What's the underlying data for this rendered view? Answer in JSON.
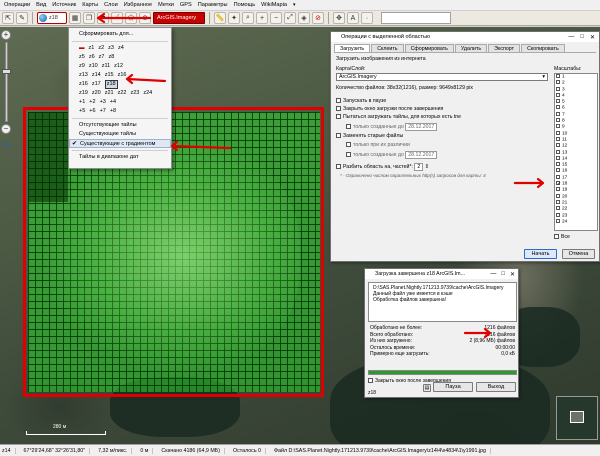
{
  "menu": {
    "items": [
      "Операции",
      "Вид",
      "Источник",
      "Карты",
      "Слои",
      "Избранное",
      "Метки",
      "GPS",
      "Параметры",
      "Помощь"
    ],
    "wikimapia": "WikiMapia"
  },
  "toolbar": {
    "zoom_value": "z18",
    "map_source": "ArcGIS.Imagery"
  },
  "zoom_slider": {
    "label": "z14"
  },
  "dropdown": {
    "header": "Сформировать для...",
    "zoom_rows": [
      [
        "z1",
        "z2",
        "z3",
        "z4"
      ],
      [
        "z5",
        "z6",
        "z7",
        "z8"
      ],
      [
        "z9",
        "z10",
        "z11",
        "z12"
      ],
      [
        "z13",
        "z14",
        "z15",
        "z16"
      ],
      [
        "z16",
        "z17",
        "z18"
      ],
      [
        "z19",
        "z20",
        "z21",
        "z22",
        "z23",
        "z24"
      ]
    ],
    "offset_rows": [
      [
        "+1",
        "+2",
        "+3",
        "+4"
      ],
      [
        "+5",
        "+6",
        "+7",
        "+8"
      ]
    ],
    "highlighted_zoom": "z18",
    "options": [
      "Отсутствующие тайлы",
      "Существующие тайлы",
      "Существующие с градиентом"
    ],
    "checked_option": "Существующие с градиентом",
    "footer": "Тайлы в диапазоне дат"
  },
  "op_dialog": {
    "title": "Операции с выделенной областью",
    "tabs": [
      "Загрузить",
      "Склеить",
      "Сформировать",
      "Удалить",
      "Экспорт",
      "Скопировать"
    ],
    "active_tab": "Загрузить",
    "section_label": "Загрузить изображения из интернета",
    "map_layer_label": "Карта/Слой:",
    "map_layer_value": "ArcGIS.Imagery",
    "count_label": "Количество файлов: 38х32(1216), размер: 9649х8129 pix",
    "options": [
      {
        "label": "Запускать в паузе",
        "checked": false
      },
      {
        "label": "Закрыть окно загрузки после завершения",
        "checked": false
      },
      {
        "label": "Пытаться загружать тайлы, для которых есть tne",
        "checked": false
      },
      {
        "label": "только созданные до",
        "checked": false,
        "date": "28.12.2017"
      },
      {
        "label": "Заменять старые файлы",
        "checked": false
      },
      {
        "label": "только при их различии",
        "checked": false
      },
      {
        "label": "только созданные до",
        "checked": false,
        "date": "28.12.2017"
      },
      {
        "label": "Разбить область на, частей*:",
        "checked": false,
        "value": "2"
      }
    ],
    "note": "* - Ограничено числом параллельных http(s) запросов для карты: 4",
    "scales_label": "Масштабы:",
    "scales": [
      "1",
      "2",
      "3",
      "4",
      "5",
      "6",
      "7",
      "8",
      "9",
      "10",
      "11",
      "12",
      "13",
      "14",
      "15",
      "16",
      "17",
      "18",
      "19",
      "20",
      "21",
      "22",
      "23",
      "24"
    ],
    "checked_scale": "18",
    "all_label": "Все",
    "start_button": "Начать",
    "cancel_button": "Отмена"
  },
  "dl_dialog": {
    "title": "Загрузка завершена z18 ArcGIS.Im...",
    "log_lines": [
      "D:\\SAS.Planet.Nightly.171213.9739\\cache\\ArcGIS.Imagery",
      "Данный файл уже имеется в кэше",
      "Обработка файлов завершена!"
    ],
    "stats": [
      {
        "label": "Обработано не более:",
        "value": "1216 файлов"
      },
      {
        "label": "Всего обработано:",
        "value": "1216 файлов"
      },
      {
        "label": "Из них загружено:",
        "value": "2 (8,96 МБ) файлов"
      },
      {
        "label": "Осталось времени:",
        "value": "00:00:00"
      },
      {
        "label": "Примерно еще загрузить:",
        "value": "0,0 кБ"
      }
    ],
    "progress": 1.0,
    "close_after_label": "Закрыть окно после завершения",
    "zoom_label": "z18",
    "pause_button": "Пауза",
    "exit_button": "Выход"
  },
  "map": {
    "scale_label": "280 м"
  },
  "status": {
    "zoom": "z14",
    "coords": "67°29'24,68\" 32°26'31,80\"",
    "scale": "7,32 м/пикс.",
    "elevation": "0 м",
    "downloaded": "Скачано 4186 (64,9 МБ)",
    "remaining": "Осталось 0",
    "file": "Файл D:\\SAS.Planet.Nightly.171213.9739\\cache\\ArcGIS.Imagery\\z14\\4\\x4834\\1\\y1991.jpg"
  },
  "colors": {
    "annotation_red": "#e00000",
    "grid_green": "#2ed62e",
    "progress_green": "#2d9a2d"
  }
}
